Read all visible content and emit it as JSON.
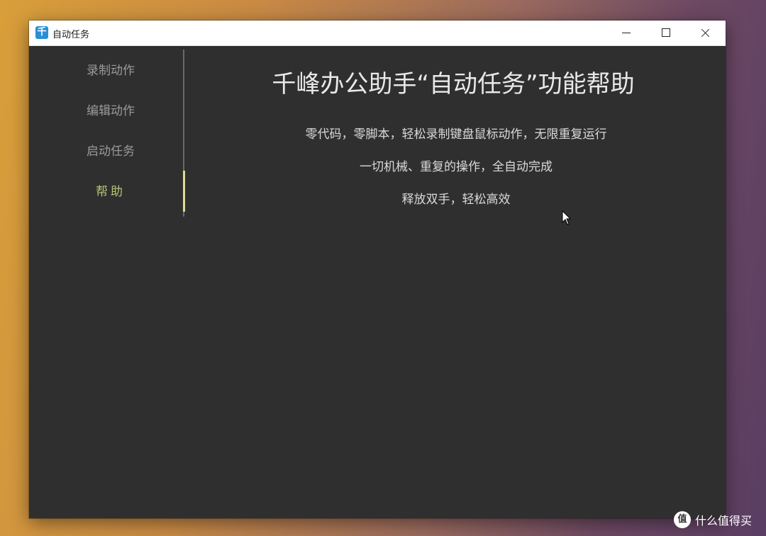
{
  "window": {
    "title": "自动任务",
    "app_icon_glyph": "千"
  },
  "sidebar": {
    "items": [
      {
        "label": "录制动作"
      },
      {
        "label": "编辑动作"
      },
      {
        "label": "启动任务"
      },
      {
        "label": "帮助",
        "active": true
      }
    ]
  },
  "main": {
    "title": "千峰办公助手“自动任务”功能帮助",
    "lines": [
      "零代码，零脚本，轻松录制键盘鼠标动作，无限重复运行",
      "一切机械、重复的操作，全自动完成",
      "释放双手，轻松高效"
    ]
  },
  "watermark": {
    "logo_glyph": "值",
    "text": "什么值得买"
  },
  "colors": {
    "window_bg": "#2f2f2f",
    "active_nav": "#b3c774",
    "active_indicator": "#d9de94",
    "app_icon": "#2a8fd6"
  },
  "icons": [
    "app-icon",
    "minimize-icon",
    "maximize-icon",
    "close-icon",
    "mouse-cursor-icon"
  ]
}
